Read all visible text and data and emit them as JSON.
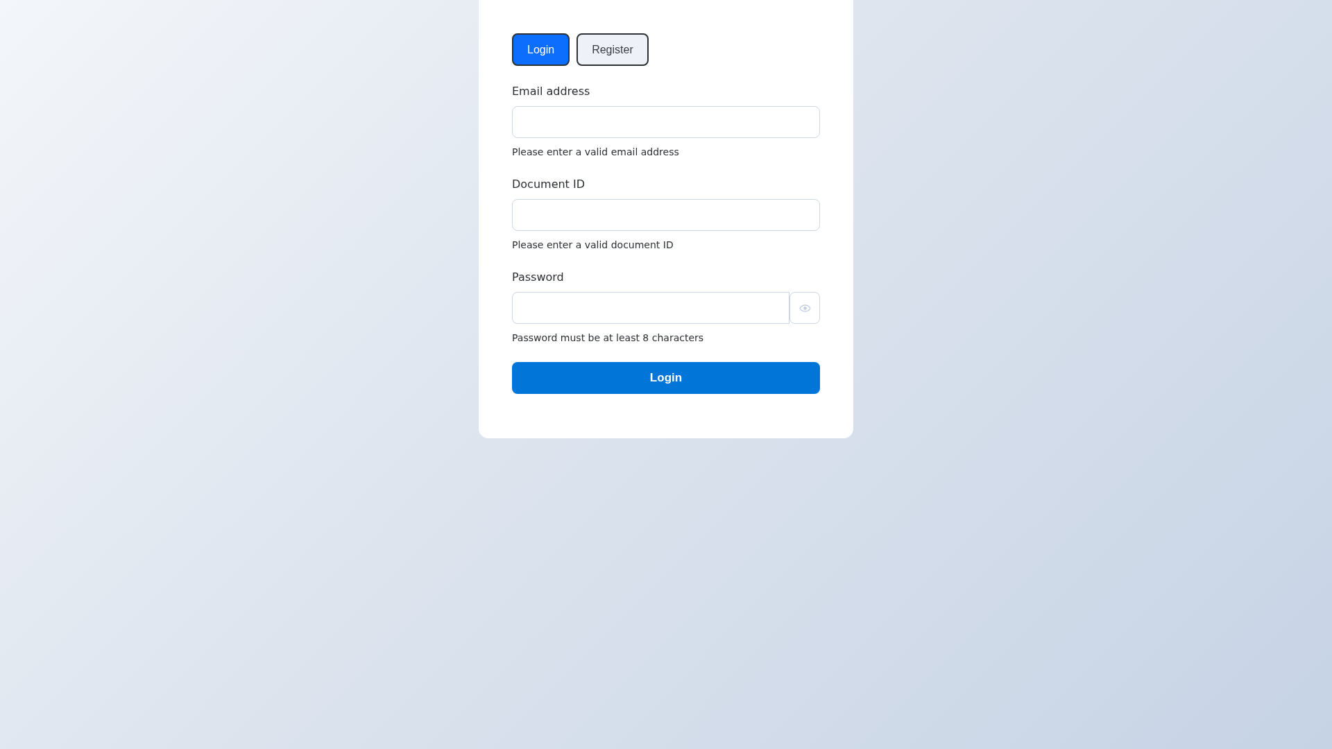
{
  "tabs": [
    {
      "label": "Login",
      "selected": true
    },
    {
      "label": "Register",
      "selected": false
    }
  ],
  "fields": [
    {
      "label": "Email address",
      "kind": "text",
      "hint": "Please enter a valid email address"
    },
    {
      "label": "Document ID",
      "kind": "text",
      "hint": "Please enter a valid document ID"
    },
    {
      "label": "Password",
      "kind": "password",
      "hint": "Password must be at least 8 characters"
    }
  ],
  "submit": "Login"
}
